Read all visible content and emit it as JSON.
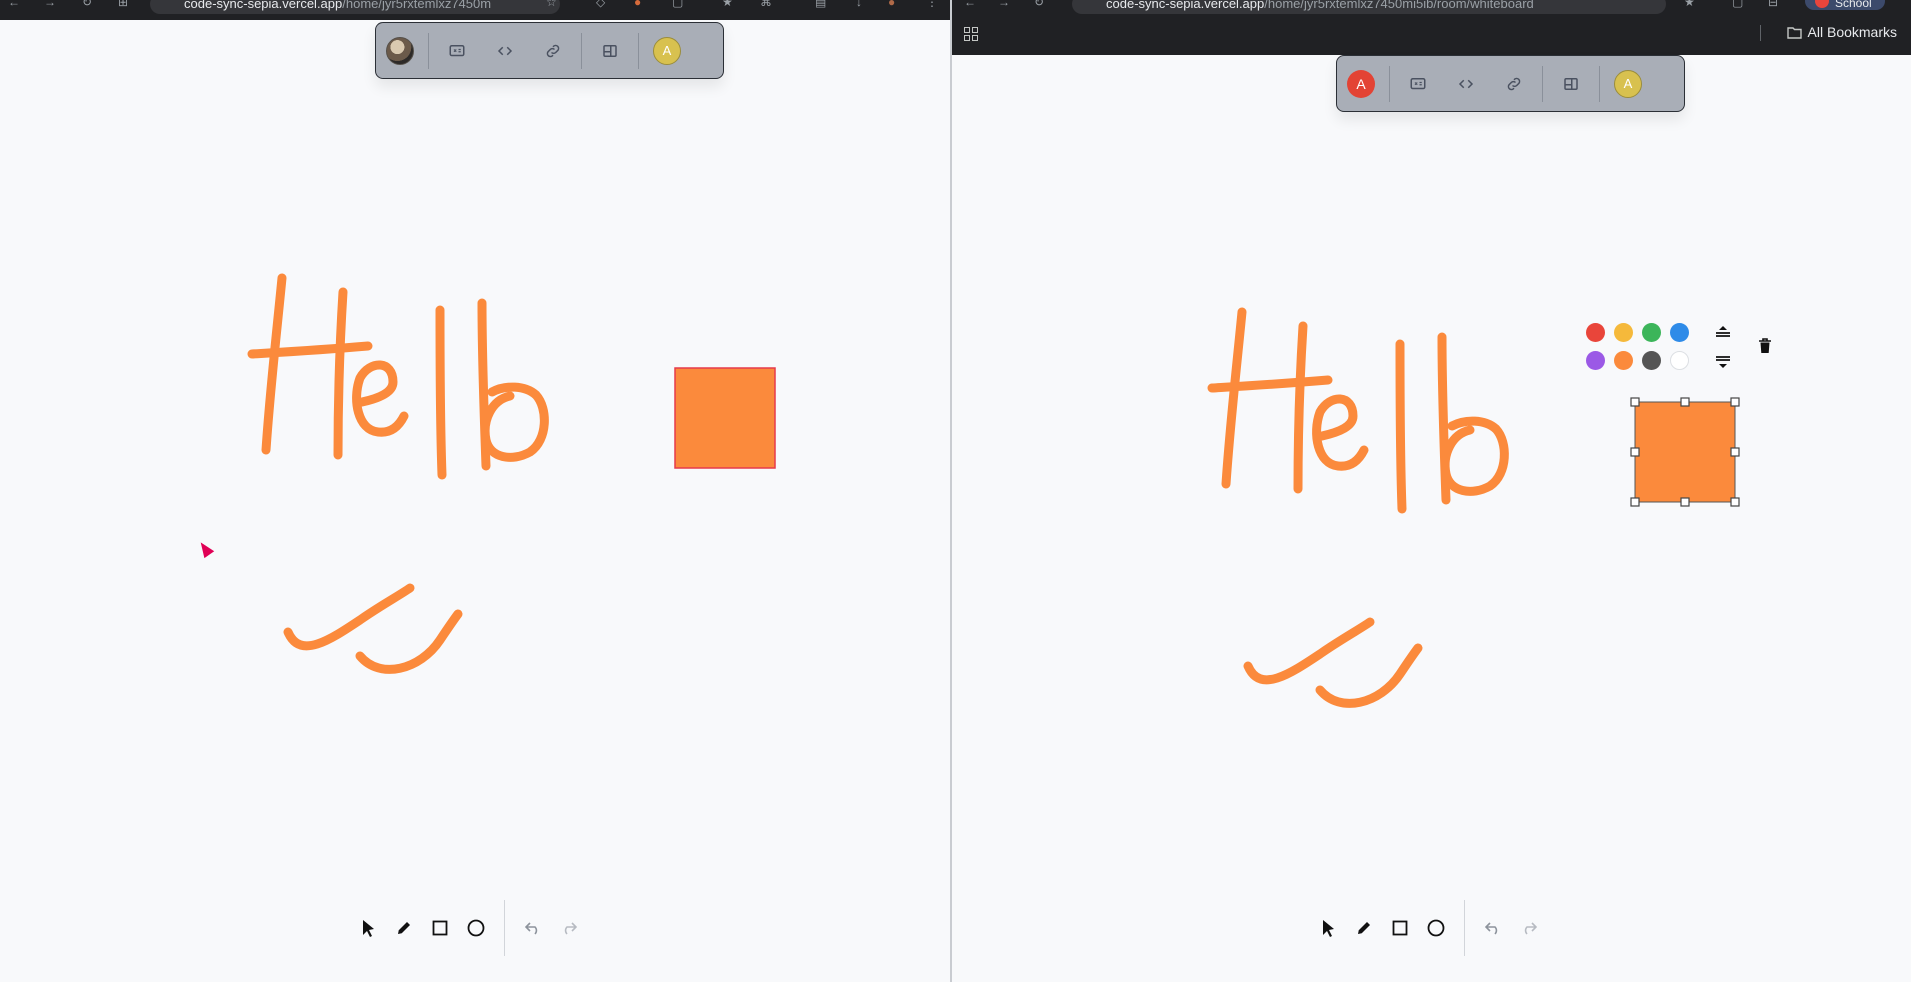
{
  "left_browser": {
    "address": {
      "host": "code-sync-sepia.vercel.app",
      "path": "/home/jyr5rxtemlxz7450m"
    },
    "toolbar": {
      "share_screen_icon": "screen-share-icon",
      "code_icon": "code-icon",
      "link_icon": "link-icon",
      "panel_icon": "side-panel-icon",
      "user_avatar_letter": "A"
    }
  },
  "right_browser": {
    "address": {
      "host": "code-sync-sepia.vercel.app",
      "path": "/home/jyr5rxtemlxz7450mi5ib/room/whiteboard"
    },
    "profile_label": "School",
    "bookmarks_label": "All Bookmarks",
    "toolbar": {
      "self_avatar_letter": "A",
      "user_avatar_letter": "A"
    },
    "palette": {
      "colors": [
        "#e9453a",
        "#f5b93b",
        "#3cb55a",
        "#2e8be8",
        "#9b59e6",
        "#fb8a3c",
        "#555555",
        "#ffffff"
      ],
      "bring_forward_icon": "bring-forward-icon",
      "send_backward_icon": "send-backward-icon",
      "delete_icon": "trash-icon"
    }
  },
  "drawing": {
    "stroke_color": "#fb8a3c",
    "rect_fill": "#fb8a3c",
    "rect_border_left": "#e63a4b"
  },
  "bottom_tools": {
    "tools": [
      "select-tool",
      "pencil-tool",
      "rectangle-tool",
      "circle-tool"
    ],
    "history": [
      "undo-button",
      "redo-button"
    ]
  }
}
